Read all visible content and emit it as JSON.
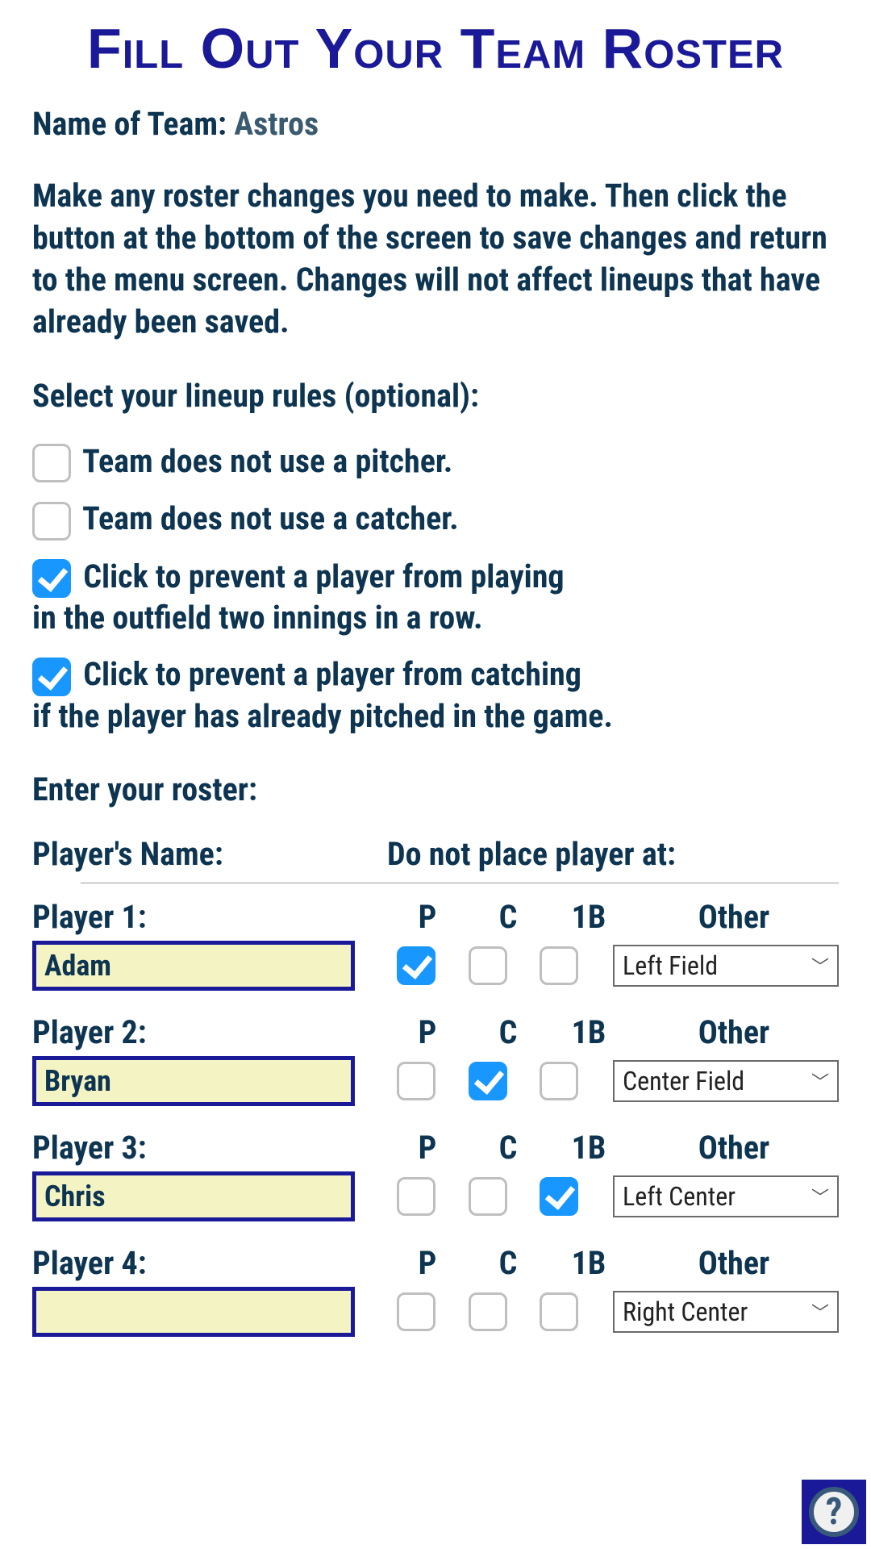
{
  "title": "Fill Out Your Team Roster",
  "team": {
    "label": "Name of Team:",
    "name": "Astros"
  },
  "instructions": "Make any roster changes you need to make. Then click the button at the bottom of the screen to save changes and return to the menu screen. Changes will not affect lineups that have already been saved.",
  "rules_header": "Select your lineup rules (optional):",
  "rules": [
    {
      "label": "Team does not use a pitcher.",
      "checked": false
    },
    {
      "label": "Team does not use a catcher.",
      "checked": false
    },
    {
      "label_line1": "Click to prevent a player from playing",
      "label_line2": "in the outfield two innings in a row.",
      "checked": true
    },
    {
      "label_line1": "Click to prevent a player from catching",
      "label_line2": "if the player has already pitched in the game.",
      "checked": true
    }
  ],
  "roster_header": "Enter your roster:",
  "columns": {
    "name": "Player's Name:",
    "restrict": "Do not place player at:"
  },
  "pos_labels": {
    "p": "P",
    "c": "C",
    "b1": "1B",
    "other": "Other"
  },
  "players": [
    {
      "label": "Player 1:",
      "name": "Adam",
      "p": true,
      "c": false,
      "b1": false,
      "other": "Left Field"
    },
    {
      "label": "Player 2:",
      "name": "Bryan",
      "p": false,
      "c": true,
      "b1": false,
      "other": "Center Field"
    },
    {
      "label": "Player 3:",
      "name": "Chris",
      "p": false,
      "c": false,
      "b1": true,
      "other": "Left Center"
    },
    {
      "label": "Player 4:",
      "name": "",
      "p": false,
      "c": false,
      "b1": false,
      "other": "Right Center"
    }
  ],
  "help": "?"
}
